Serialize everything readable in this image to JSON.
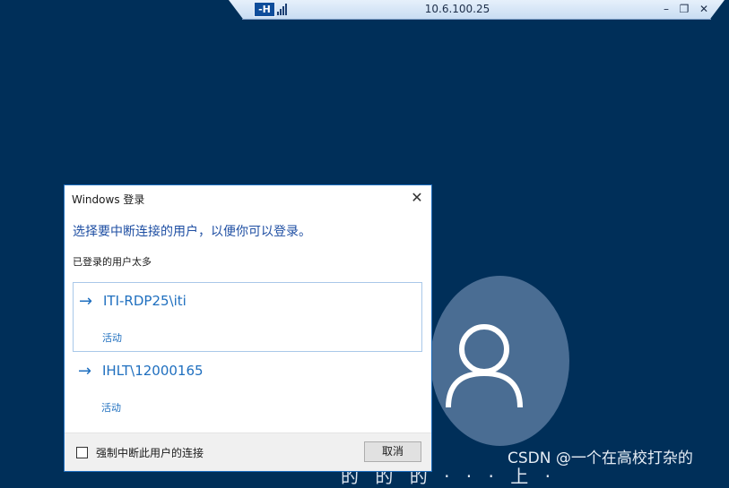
{
  "rdp_bar": {
    "pin_label": "-H",
    "title": "10.6.100.25",
    "minimize": "–",
    "restore": "❐",
    "close": "✕"
  },
  "background": {
    "partial_text": "的 的 的 · · · 上 ·",
    "watermark": "CSDN @一个在高校打杂的"
  },
  "dialog": {
    "title": "Windows 登录",
    "close": "✕",
    "heading": "选择要中断连接的用户，以便你可以登录。",
    "subheading": "已登录的用户太多",
    "users": [
      {
        "arrow": "→",
        "name": "ITI-RDP25\\iti",
        "status": "活动"
      },
      {
        "arrow": "→",
        "name": "IHLT\\12000165",
        "status": "活动"
      }
    ],
    "checkbox_label": "强制中断此用户的连接",
    "cancel_label": "取消"
  },
  "colors": {
    "desktop_bg": "#002f59",
    "accent": "#1f6fbf",
    "avatar_bg": "#4a6d93"
  }
}
